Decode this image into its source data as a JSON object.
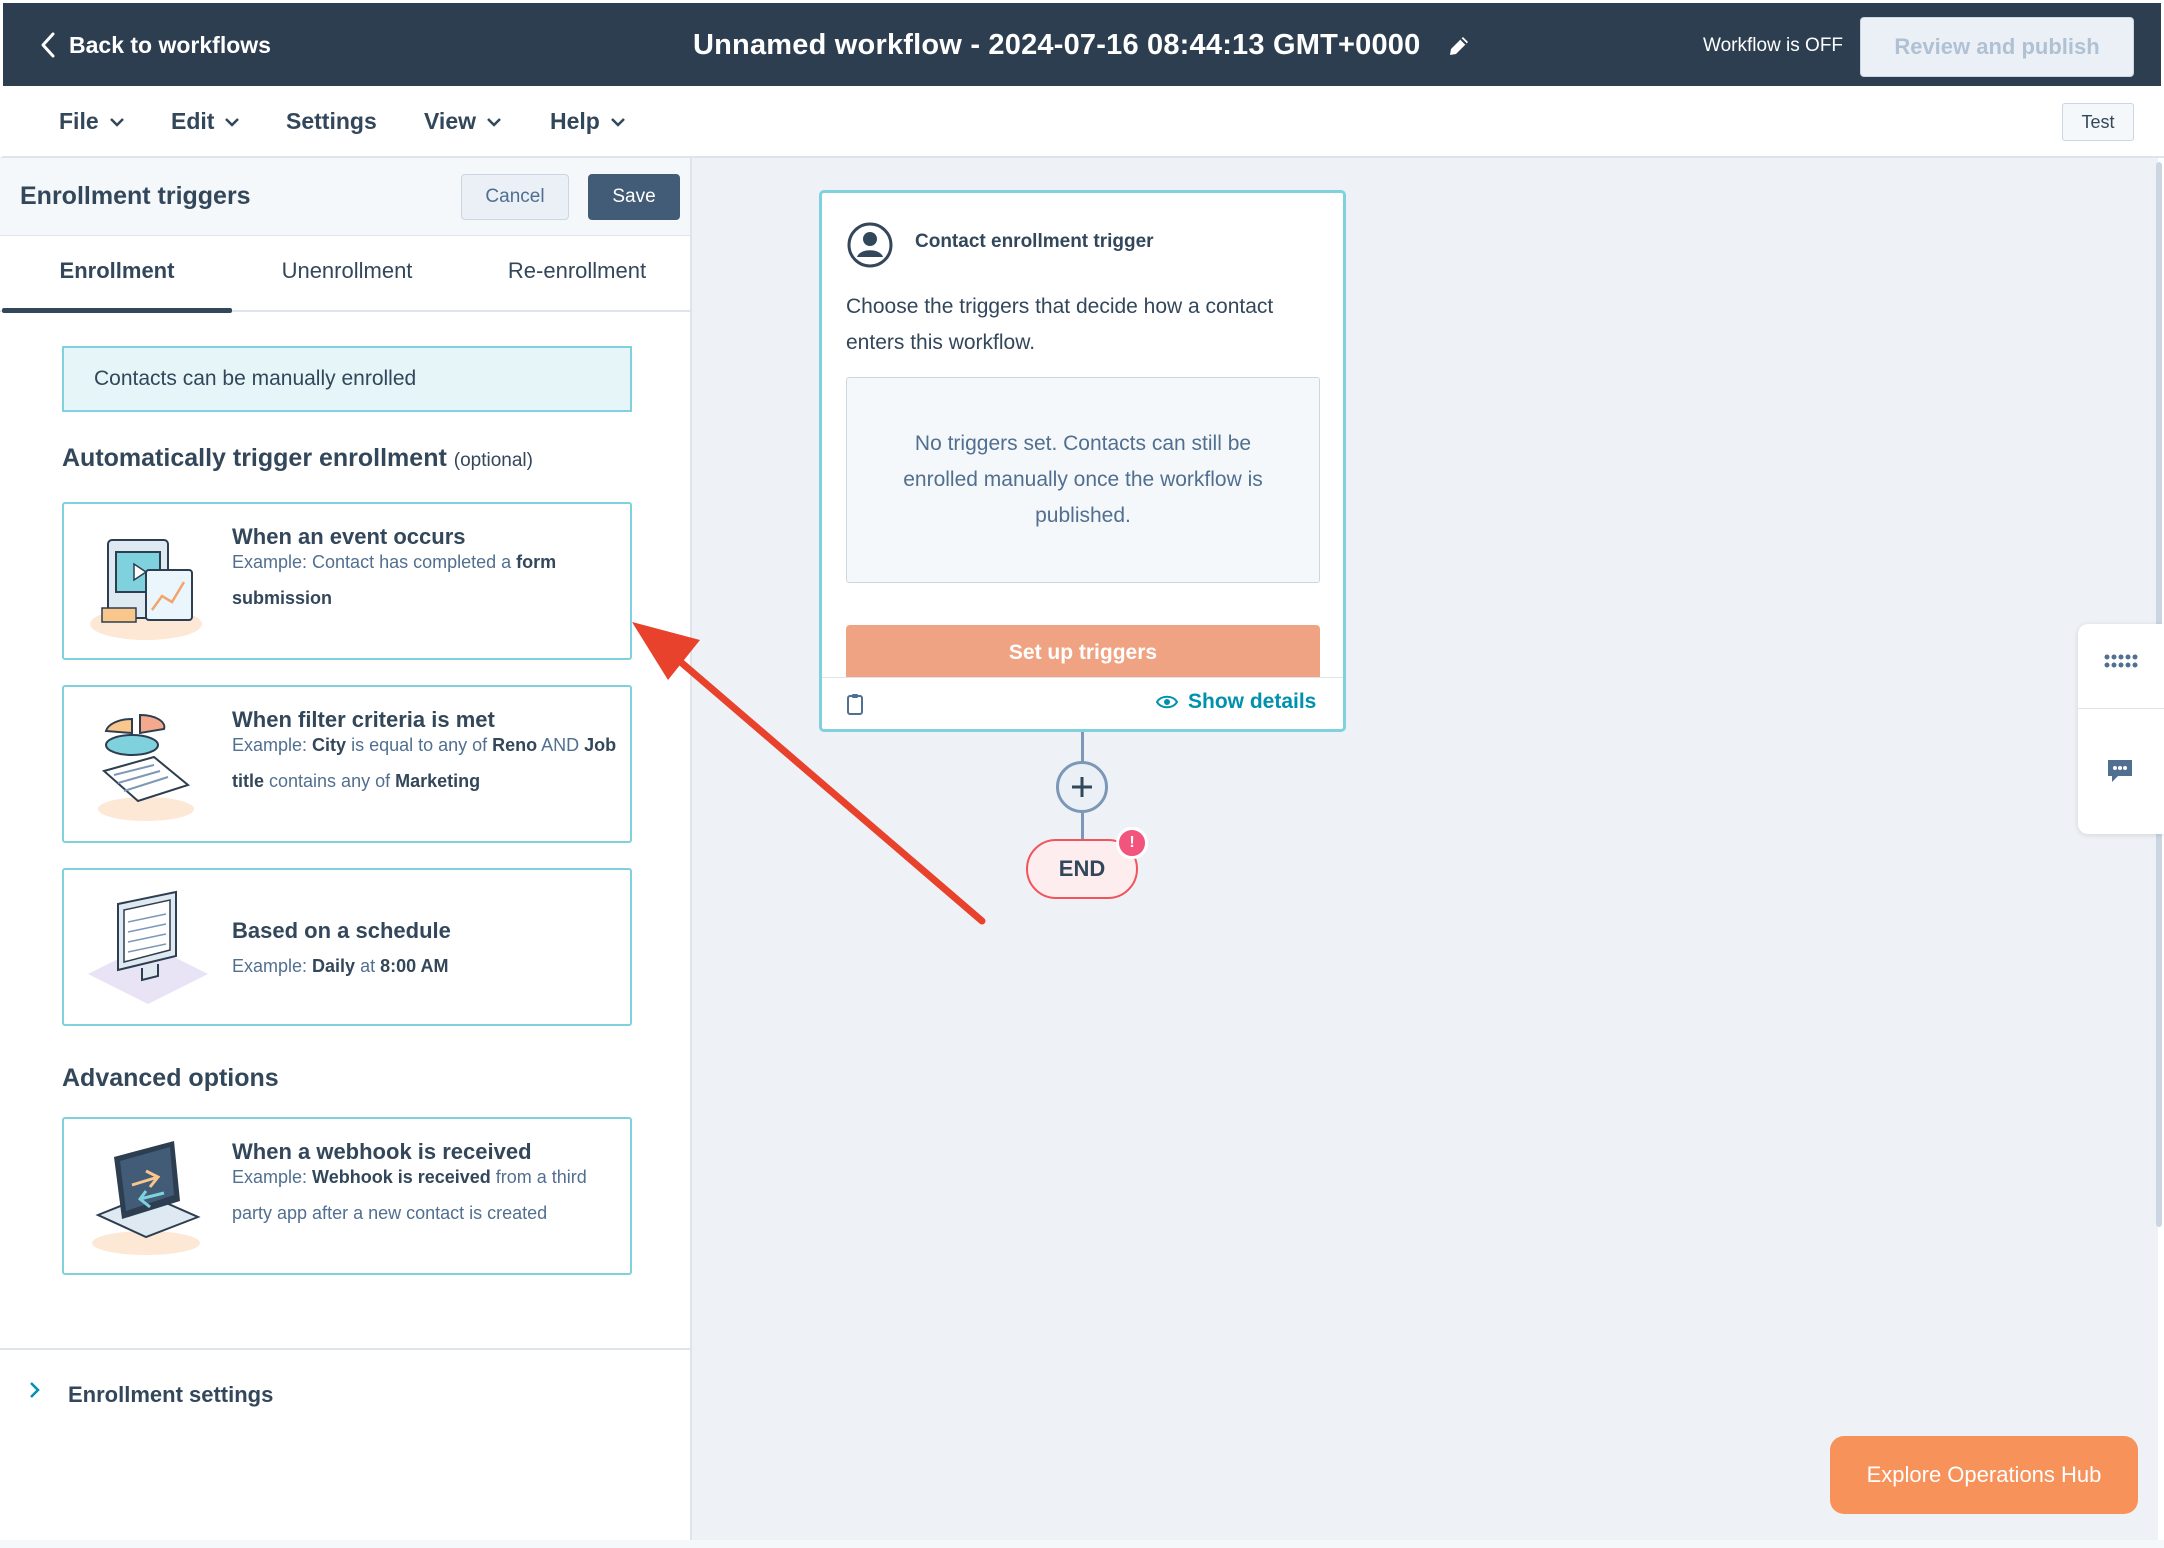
{
  "header": {
    "back_label": "Back to workflows",
    "workflow_title": "Unnamed workflow - 2024-07-16 08:44:13 GMT+0000",
    "status": "Workflow is OFF",
    "review_publish_label": "Review and publish"
  },
  "menu": {
    "items": [
      {
        "label": "File",
        "has_dropdown": true
      },
      {
        "label": "Edit",
        "has_dropdown": true
      },
      {
        "label": "Settings",
        "has_dropdown": false
      },
      {
        "label": "View",
        "has_dropdown": true
      },
      {
        "label": "Help",
        "has_dropdown": true
      }
    ],
    "test_label": "Test"
  },
  "panel": {
    "title": "Enrollment triggers",
    "cancel_label": "Cancel",
    "save_label": "Save",
    "tabs": [
      {
        "label": "Enrollment",
        "active": true
      },
      {
        "label": "Unenrollment",
        "active": false
      },
      {
        "label": "Re-enrollment",
        "active": false
      }
    ],
    "manual_notice": "Contacts can be manually enrolled",
    "auto_section": {
      "title": "Automatically trigger enrollment",
      "optional": "(optional)"
    },
    "cards": [
      {
        "title": "When an event occurs",
        "desc_parts": [
          {
            "text": "Example: Contact has completed a ",
            "bold": false
          },
          {
            "text": "form submission",
            "bold": true
          }
        ]
      },
      {
        "title": "When filter criteria is met",
        "desc_parts": [
          {
            "text": "Example: ",
            "bold": false
          },
          {
            "text": "City",
            "bold": true
          },
          {
            "text": " is equal to any of ",
            "bold": false
          },
          {
            "text": "Reno",
            "bold": true
          },
          {
            "text": " AND ",
            "bold": false
          },
          {
            "text": "Job title",
            "bold": true
          },
          {
            "text": " contains any of ",
            "bold": false
          },
          {
            "text": "Marketing",
            "bold": true
          }
        ]
      },
      {
        "title": "Based on a schedule",
        "desc_parts": [
          {
            "text": "Example: ",
            "bold": false
          },
          {
            "text": "Daily",
            "bold": true
          },
          {
            "text": " at ",
            "bold": false
          },
          {
            "text": "8:00 AM",
            "bold": true
          }
        ]
      }
    ],
    "advanced_title": "Advanced options",
    "advanced_card": {
      "title": "When a webhook is received",
      "desc_parts": [
        {
          "text": "Example: ",
          "bold": false
        },
        {
          "text": "Webhook is received",
          "bold": true
        },
        {
          "text": " from a third party app after a new contact is created",
          "bold": false
        }
      ]
    },
    "settings_label": "Enrollment settings"
  },
  "canvas": {
    "trigger_card": {
      "title": "Contact enrollment trigger",
      "description": "Choose the triggers that decide how a contact enters this workflow.",
      "empty_text": "No triggers set. Contacts can still be enrolled manually once the workflow is published.",
      "setup_label": "Set up triggers",
      "show_details_label": "Show details"
    },
    "end_label": "END",
    "end_badge": "!"
  },
  "explore_label": "Explore Operations Hub",
  "colors": {
    "header_bg": "#2d3e50",
    "accent_teal": "#7fd1de",
    "setup_orange": "#f0a383",
    "explore_orange": "#f7925b",
    "arrow_red": "#e8412c",
    "link_teal": "#0091ae"
  },
  "icons": [
    "chevron-left-icon",
    "pencil-icon",
    "chevron-down-icon",
    "contact-icon",
    "clipboard-icon",
    "eye-icon",
    "plus-icon",
    "grid-icon",
    "chat-icon",
    "chevron-right-icon"
  ]
}
